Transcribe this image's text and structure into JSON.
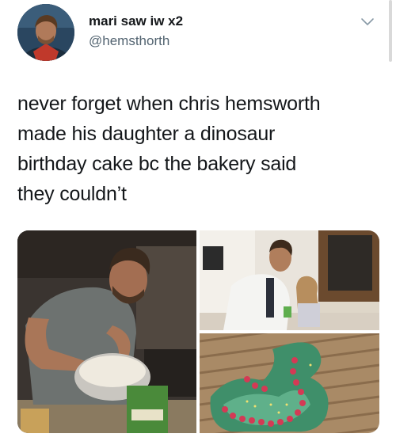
{
  "tweet": {
    "display_name": "mari saw iw x2",
    "handle": "@hemsthorth",
    "text_lines": [
      "never forget when chris hemsworth",
      "made his daughter a dinosaur",
      "birthday cake bc the bakery said",
      "they couldn’t"
    ]
  },
  "icons": {
    "avatar": "avatar-photo",
    "menu": "chevron-down-icon"
  },
  "colors": {
    "text": "#14171a",
    "secondary_text": "#536471",
    "chevron": "#8899a6"
  },
  "media": {
    "photos": [
      "man-mixing-cake-batter-photo",
      "man-with-daughter-photo",
      "dinosaur-cake-photo"
    ]
  }
}
